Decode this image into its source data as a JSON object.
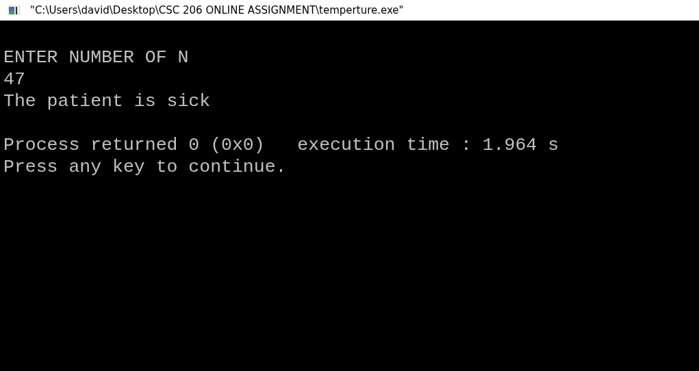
{
  "window": {
    "title": "\"C:\\Users\\david\\Desktop\\CSC 206 ONLINE ASSIGNMENT\\temperture.exe\""
  },
  "console": {
    "blocks": [
      [
        "ENTER NUMBER OF N",
        "47",
        "The patient is sick"
      ],
      [
        "Process returned 0 (0x0)   execution time : 1.964 s",
        "Press any key to continue."
      ]
    ]
  }
}
